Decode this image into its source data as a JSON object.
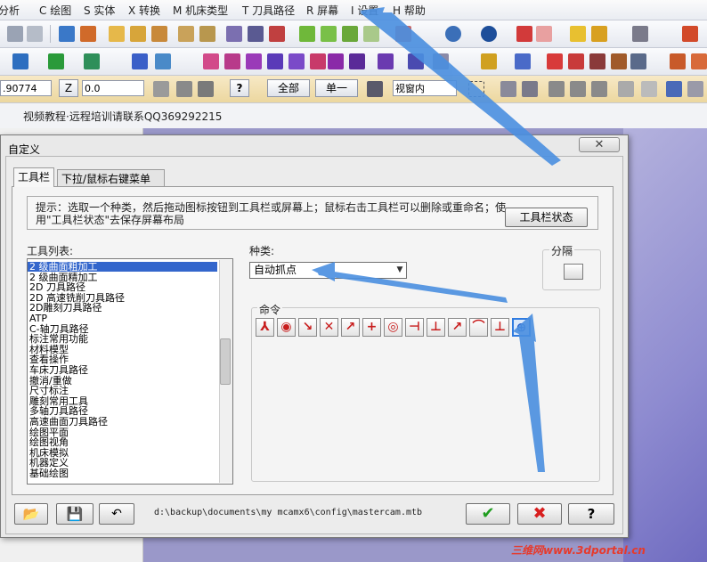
{
  "menu": {
    "items": [
      "分析",
      "C 绘图",
      "S 实体",
      "X 转换",
      "M 机床类型",
      "T 刀具路径",
      "R 屏幕",
      "I 设置",
      "H 帮助"
    ]
  },
  "toolbar3": {
    "value_field": ".90774",
    "z_label": "Z",
    "z_value": "0.0",
    "all_button": "全部",
    "single_button": "单一",
    "view_select": "视窗内"
  },
  "caption": "视频教程·远程培训请联系QQ369292215",
  "dialog": {
    "title": "自定义",
    "close_glyph": "✕",
    "tabs": [
      "工具栏",
      "下拉/鼠标右键菜单"
    ],
    "hint": "提示：选取一个种类，然后拖动图标按钮到工具栏或屏幕上；鼠标右击工具栏可以删除或重命名；使用\"工具栏状态\"去保存屏幕布局",
    "status_button": "工具栏状态",
    "list_label": "工具列表:",
    "tool_list": [
      "2 级曲面粗加工",
      "2 级曲面精加工",
      "2D 刀具路径",
      "2D 高速铣削刀具路径",
      "2D雕刻刀具路径",
      "ATP",
      "C-轴刀具路径",
      "标注常用功能",
      "材料模型",
      "查看操作",
      "车床刀具路径",
      "撤消/重做",
      "尺寸标注",
      "雕刻常用工具",
      "多轴刀具路径",
      "高速曲面刀具路径",
      "绘图平面",
      "绘图视角",
      "机床模拟",
      "机器定义",
      "基础绘图"
    ],
    "selected_index": 0,
    "kind_label": "种类:",
    "kind_value": "自动抓点",
    "separator_label": "分隔",
    "commands_label": "命令",
    "commands": [
      "origin-snap-icon",
      "center-snap-icon",
      "endpoint-snap-icon",
      "intersection-snap-icon",
      "midpoint-snap-icon",
      "point-snap-icon",
      "quadrant-snap-icon",
      "nearest-snap-icon",
      "tangent-snap-icon",
      "perpendicular-snap-icon",
      "arc-snap-icon",
      "horizontal-snap-icon",
      "relative-snap-icon"
    ],
    "path": "d:\\backup\\documents\\my mcamx6\\config\\mastercam.mtb"
  },
  "colors": {
    "arrow": "#4a8fe0",
    "ok": "#1f9d1f",
    "cancel": "#d81e1e",
    "selection": "#2f7be0"
  },
  "watermark": "三维网www.3dportal.cn"
}
